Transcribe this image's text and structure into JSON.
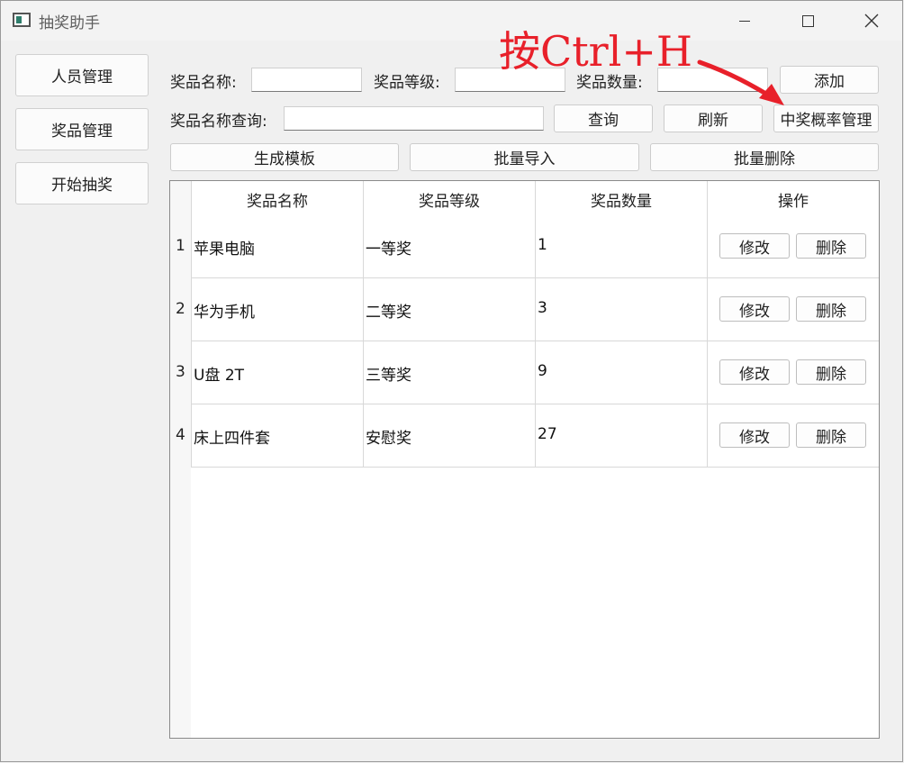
{
  "window": {
    "title": "抽奖助手",
    "controls": {
      "minimize_icon": "minimize-icon",
      "maximize_icon": "maximize-icon",
      "close_icon": "close-icon"
    }
  },
  "sidebar": {
    "items": [
      {
        "label": "人员管理"
      },
      {
        "label": "奖品管理"
      },
      {
        "label": "开始抽奖"
      }
    ]
  },
  "form": {
    "name_label": "奖品名称:",
    "name_value": "",
    "level_label": "奖品等级:",
    "level_value": "",
    "qty_label": "奖品数量:",
    "qty_value": "",
    "add_button": "添加",
    "query_label": "奖品名称查询:",
    "query_value": "",
    "query_button": "查询",
    "refresh_button": "刷新",
    "probability_button": "中奖概率管理",
    "template_button": "生成模板",
    "import_button": "批量导入",
    "batch_delete_button": "批量删除"
  },
  "table": {
    "headers": [
      "奖品名称",
      "奖品等级",
      "奖品数量",
      "操作"
    ],
    "rows": [
      {
        "num": "1",
        "name": "苹果电脑",
        "level": "一等奖",
        "qty": "1",
        "edit": "修改",
        "delete": "删除"
      },
      {
        "num": "2",
        "name": "华为手机",
        "level": "二等奖",
        "qty": "3",
        "edit": "修改",
        "delete": "删除"
      },
      {
        "num": "3",
        "name": "U盘 2T",
        "level": "三等奖",
        "qty": "9",
        "edit": "修改",
        "delete": "删除"
      },
      {
        "num": "4",
        "name": "床上四件套",
        "level": "安慰奖",
        "qty": "27",
        "edit": "修改",
        "delete": "删除"
      }
    ]
  },
  "annotation": {
    "text": "按Ctrl+H",
    "color": "#e8202a"
  }
}
